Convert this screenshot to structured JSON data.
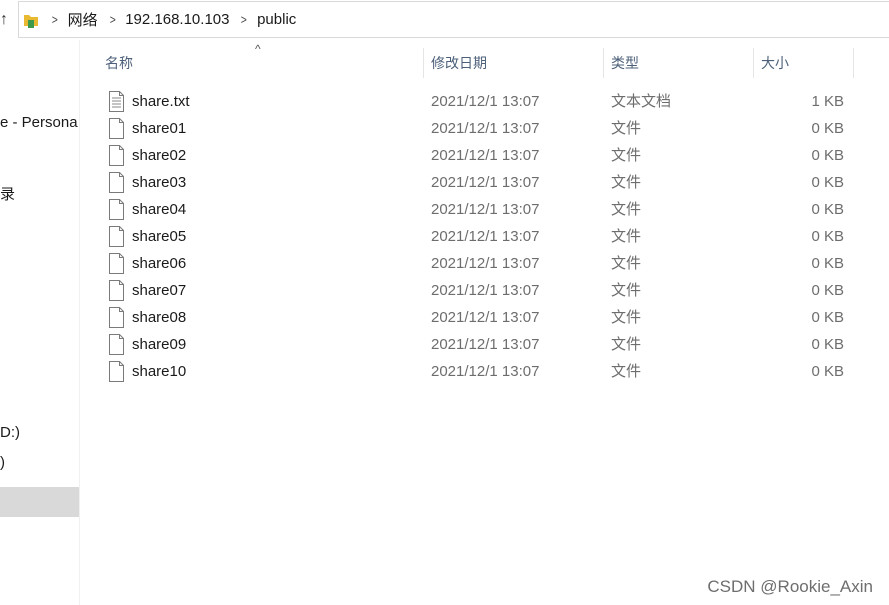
{
  "address": {
    "crumbs": [
      "网络",
      "192.168.10.103",
      "public"
    ]
  },
  "nav": {
    "items": [
      {
        "label": "e - Persona"
      },
      {
        "label": "录"
      },
      {
        "label": "D:)"
      },
      {
        "label": ")"
      }
    ]
  },
  "columns": {
    "name": "名称",
    "date": "修改日期",
    "type": "类型",
    "size": "大小"
  },
  "files": [
    {
      "name": "share.txt",
      "date": "2021/12/1 13:07",
      "type": "文本文档",
      "size": "1 KB",
      "icon": "text-file-icon"
    },
    {
      "name": "share01",
      "date": "2021/12/1 13:07",
      "type": "文件",
      "size": "0 KB",
      "icon": "file-icon"
    },
    {
      "name": "share02",
      "date": "2021/12/1 13:07",
      "type": "文件",
      "size": "0 KB",
      "icon": "file-icon"
    },
    {
      "name": "share03",
      "date": "2021/12/1 13:07",
      "type": "文件",
      "size": "0 KB",
      "icon": "file-icon"
    },
    {
      "name": "share04",
      "date": "2021/12/1 13:07",
      "type": "文件",
      "size": "0 KB",
      "icon": "file-icon"
    },
    {
      "name": "share05",
      "date": "2021/12/1 13:07",
      "type": "文件",
      "size": "0 KB",
      "icon": "file-icon"
    },
    {
      "name": "share06",
      "date": "2021/12/1 13:07",
      "type": "文件",
      "size": "0 KB",
      "icon": "file-icon"
    },
    {
      "name": "share07",
      "date": "2021/12/1 13:07",
      "type": "文件",
      "size": "0 KB",
      "icon": "file-icon"
    },
    {
      "name": "share08",
      "date": "2021/12/1 13:07",
      "type": "文件",
      "size": "0 KB",
      "icon": "file-icon"
    },
    {
      "name": "share09",
      "date": "2021/12/1 13:07",
      "type": "文件",
      "size": "0 KB",
      "icon": "file-icon"
    },
    {
      "name": "share10",
      "date": "2021/12/1 13:07",
      "type": "文件",
      "size": "0 KB",
      "icon": "file-icon"
    }
  ],
  "watermark": "CSDN @Rookie_Axin",
  "colors": {
    "header_text": "#4c607a",
    "meta_text": "#6d6d6d",
    "selected_bg": "#d9d9d9",
    "folder": "#e8b931"
  }
}
